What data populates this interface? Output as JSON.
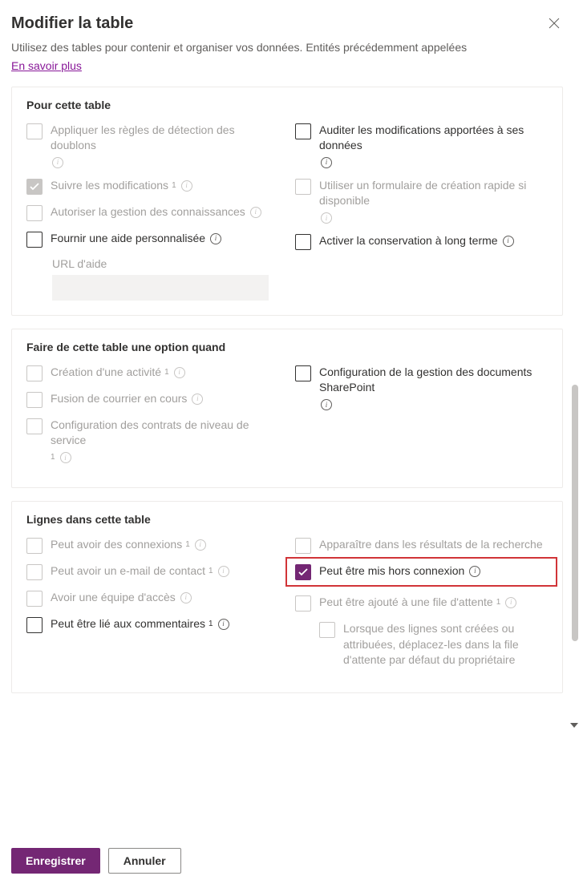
{
  "header": {
    "title": "Modifier la table",
    "subtitle": "Utilisez des tables pour contenir et organiser vos données. Entités précédemment appelées",
    "learn_more": "En savoir plus"
  },
  "section1": {
    "title": "Pour cette table",
    "left": {
      "apply_dup": "Appliquer les règles de détection des doublons",
      "track_changes": "Suivre les modifications",
      "allow_knowledge": "Autoriser la gestion des connaissances",
      "custom_help": "Fournir une aide personnalisée",
      "help_url_label": "URL d'aide"
    },
    "right": {
      "audit": "Auditer les modifications apportées à ses données",
      "quick_form": "Utiliser un formulaire de création rapide si disponible",
      "long_term": "Activer la conservation à long terme"
    }
  },
  "section2": {
    "title": "Faire de cette table une option quand",
    "left": {
      "activity": "Création d'une activité",
      "mail_merge": "Fusion de courrier en cours",
      "sla": "Configuration des contrats de niveau de service"
    },
    "right": {
      "sharepoint": "Configuration de la gestion des documents SharePoint"
    }
  },
  "section3": {
    "title": "Lignes dans cette table",
    "left": {
      "connections": "Peut avoir des connexions",
      "contact_email": "Peut avoir un e-mail de contact",
      "access_team": "Avoir une équipe d'accès",
      "feedback": "Peut être lié aux commentaires"
    },
    "right": {
      "search": "Apparaître dans les résultats de la recherche",
      "offline": "Peut être mis hors connexion",
      "queue": "Peut être ajouté à une file d'attente",
      "queue_sub": "Lorsque des lignes sont créées ou attribuées, déplacez-les dans la file d'attente par défaut du propriétaire"
    }
  },
  "footer": {
    "save": "Enregistrer",
    "cancel": "Annuler"
  }
}
